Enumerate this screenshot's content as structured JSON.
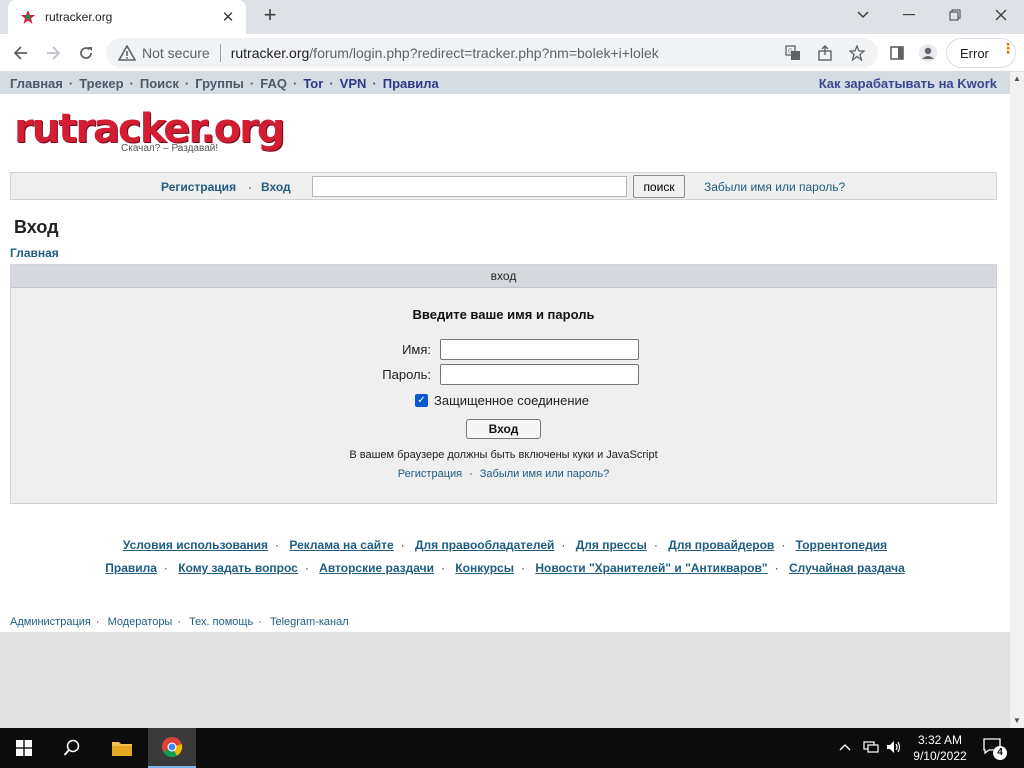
{
  "browser": {
    "tab_title": "rutracker.org",
    "not_secure": "Not secure",
    "url_host": "rutracker.org",
    "url_path": "/forum/login.php?redirect=tracker.php?nm=bolek+i+lolek",
    "error_label": "Error"
  },
  "topnav": {
    "items": [
      "Главная",
      "Трекер",
      "Поиск",
      "Группы",
      "FAQ",
      "Tor",
      "VPN",
      "Правила"
    ],
    "promo": "Как зарабатывать на Kwork"
  },
  "logo": {
    "text": "rutracker.org",
    "slogan": "Скачал? – Раздавай!"
  },
  "searchbar": {
    "register": "Регистрация",
    "login": "Вход",
    "search_value": "",
    "search_button": "поиск",
    "forgot": "Забыли имя или пароль?"
  },
  "page": {
    "title": "Вход",
    "breadcrumb": "Главная"
  },
  "login": {
    "header": "вход",
    "prompt": "Введите ваше имя и пароль",
    "name_label": "Имя:",
    "password_label": "Пароль:",
    "name_value": "",
    "password_value": "",
    "secure_label": "Защищенное соединение",
    "secure_checked": true,
    "submit": "Вход",
    "note": "В вашем браузере должны быть включены куки и JavaScript",
    "register": "Регистрация",
    "forgot": "Забыли имя или пароль?"
  },
  "footer": {
    "row1": [
      "Условия использования",
      "Реклама на сайте",
      "Для правообладателей",
      "Для прессы",
      "Для провайдеров",
      "Торрентопедия"
    ],
    "row2": [
      "Правила",
      "Кому задать вопрос",
      "Авторские раздачи",
      "Конкурсы",
      "Новости \"Хранителей\" и \"Антикваров\"",
      "Случайная раздача"
    ],
    "bottom": [
      "Администрация",
      "Модераторы",
      "Тех. помощь",
      "Telegram-канал"
    ]
  },
  "taskbar": {
    "time": "3:32 AM",
    "date": "9/10/2022",
    "notifications": "4"
  },
  "colors": {
    "link": "#1f5d81",
    "nav_bg": "#d5dce2",
    "logo_red": "#d21d33",
    "checkbox": "#0b57d0"
  }
}
